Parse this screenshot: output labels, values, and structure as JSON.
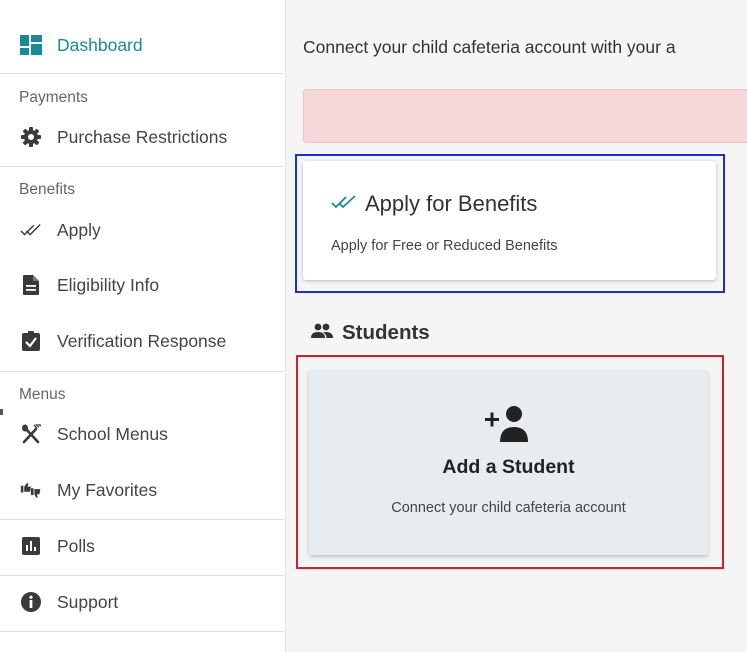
{
  "sidebar": {
    "dashboard": "Dashboard",
    "sections": {
      "payments": "Payments",
      "benefits": "Benefits",
      "menus": "Menus"
    },
    "items": {
      "purchase_restrictions": "Purchase Restrictions",
      "apply": "Apply",
      "eligibility_info": "Eligibility Info",
      "verification_response": "Verification Response",
      "school_menus": "School Menus",
      "my_favorites": "My Favorites",
      "polls": "Polls",
      "support": "Support"
    },
    "icons": {
      "dashboard": "dashboard-icon",
      "purchase_restrictions": "gear-icon",
      "apply": "double-check-icon",
      "eligibility_info": "document-icon",
      "verification_response": "clipboard-check-icon",
      "school_menus": "utensils-icon",
      "my_favorites": "thumbs-icon",
      "polls": "poll-chart-icon",
      "support": "info-icon"
    }
  },
  "main": {
    "intro": "Connect your child cafeteria account with your a",
    "benefits_card": {
      "title": "Apply for Benefits",
      "subtitle": "Apply for Free or Reduced Benefits",
      "icon": "double-check-icon"
    },
    "students": {
      "heading": "Students",
      "icon": "people-icon",
      "add_card": {
        "title": "Add a Student",
        "subtitle": "Connect your child cafeteria account",
        "icon": "add-person-icon"
      }
    }
  },
  "colors": {
    "accent": "#1a8a96",
    "alert_bg": "#f8d7da",
    "highlight_blue": "#1f2fc9",
    "highlight_red": "#d31f2a"
  }
}
